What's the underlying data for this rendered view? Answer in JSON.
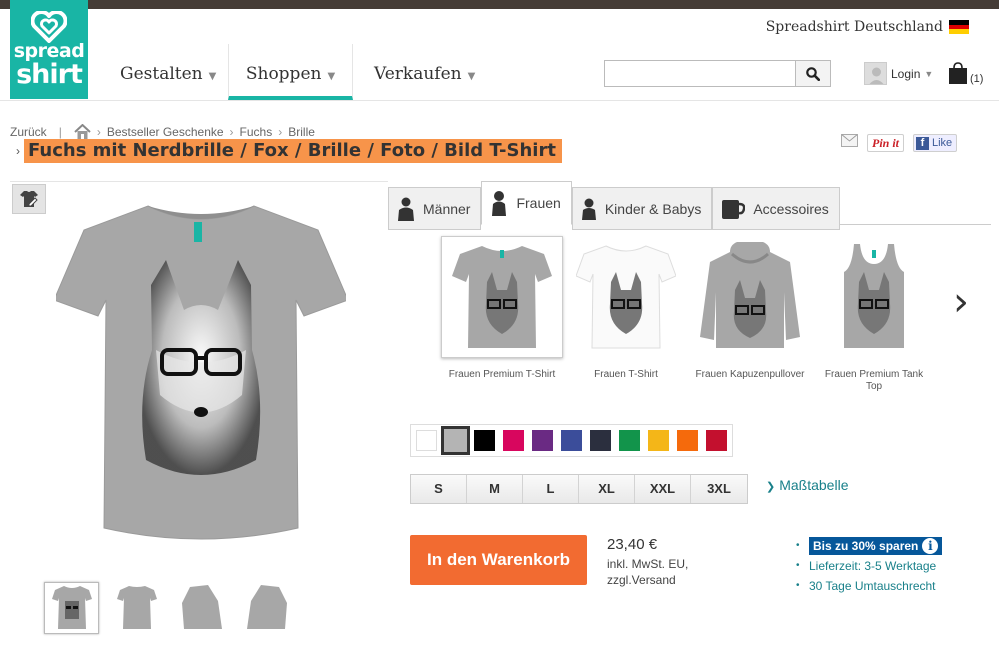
{
  "brand": {
    "logo_line1": "spread",
    "logo_line2": "shirt",
    "accent": "#19b5a5",
    "orange": "#f26b31"
  },
  "header": {
    "region": "Spreadshirt Deutschland",
    "nav": [
      {
        "label": "Gestalten"
      },
      {
        "label": "Shoppen"
      },
      {
        "label": "Verkaufen"
      }
    ],
    "search_placeholder": "",
    "login_label": "Login",
    "cart_count": "(1)"
  },
  "breadcrumb": {
    "back": "Zurück",
    "items": [
      "Bestseller Geschenke",
      "Fuchs",
      "Brille"
    ]
  },
  "product": {
    "title": "Fuchs mit Nerdbrille / Fox / Brille / Foto / Bild T-Shirt",
    "categories": [
      {
        "label": "Männer",
        "icon": "man-icon"
      },
      {
        "label": "Frauen",
        "icon": "woman-icon"
      },
      {
        "label": "Kinder & Babys",
        "icon": "child-icon"
      },
      {
        "label": "Accessoires",
        "icon": "mug-icon"
      }
    ],
    "products": [
      {
        "label": "Frauen Premium T-Shirt"
      },
      {
        "label": "Frauen T-Shirt"
      },
      {
        "label": "Frauen Kapuzenpullover"
      },
      {
        "label": "Frauen Premium Tank Top"
      }
    ],
    "colors": [
      "#ffffff",
      "#b4b4b4",
      "#000000",
      "#d8065e",
      "#6a2a83",
      "#3b4d9a",
      "#2b2f3e",
      "#12944b",
      "#f4b618",
      "#f56a0c",
      "#c3102e"
    ],
    "selected_color_index": 1,
    "sizes": [
      "S",
      "M",
      "L",
      "XL",
      "XXL",
      "3XL"
    ],
    "size_table_label": "Maßtabelle",
    "add_to_cart_label": "In den Warenkorb",
    "price": "23,40 €",
    "vat_line1": "inkl. MwSt. EU,",
    "vat_line2": "zzgl.Versand",
    "benefits": {
      "save_badge": "Bis zu 30% sparen",
      "delivery": "Lieferzeit: 3-5 Werktage",
      "return": "30 Tage Umtauschrecht"
    }
  },
  "share": {
    "pinterest": "Pin it",
    "facebook": "Like"
  }
}
